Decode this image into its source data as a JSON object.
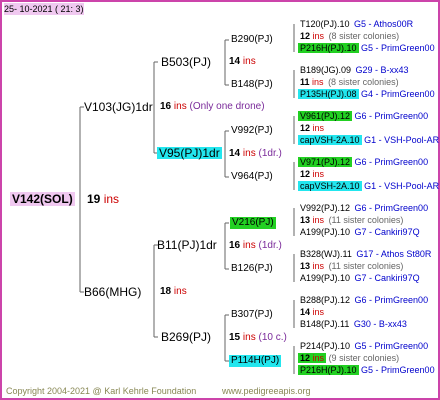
{
  "header": {
    "date": "25- 10-2021 ( 21: 3)"
  },
  "root": {
    "name": "V142(SOL)",
    "ins": "19",
    "ins_word": "ins"
  },
  "gen1": [
    {
      "name": "V103(JG)1dr",
      "ins": "16",
      "ins_word": "ins",
      "note": "(Only one drone)"
    },
    {
      "name": "B66(MHG)",
      "ins": "18",
      "ins_word": "ins"
    }
  ],
  "gen2": [
    {
      "name": "B503(PJ)",
      "ins": "14",
      "ins_word": "ins"
    },
    {
      "name": "V95(PJ)1dr",
      "ins": "14",
      "ins_word": "ins",
      "note": "(1dr.)"
    },
    {
      "name": "B11(PJ)1dr",
      "ins": "16",
      "ins_word": "ins",
      "note": "(1dr.)"
    },
    {
      "name": "B269(PJ)",
      "ins": "15",
      "ins_word": "ins",
      "note": "(10 c.)"
    }
  ],
  "gen3": [
    {
      "name": "B290(PJ)",
      "ins": "14",
      "ins_word": "ins"
    },
    {
      "name": "B148(PJ)",
      "ins": "",
      "ins_word": "ins"
    },
    {
      "name": "V992(PJ)",
      "ins": "",
      "ins_word": "ins"
    },
    {
      "name": "V964(PJ)",
      "ins": "",
      "ins_word": "ins"
    },
    {
      "name": "V216(PJ)",
      "ins": "",
      "ins_word": "ins"
    },
    {
      "name": "B126(PJ)",
      "ins": "",
      "ins_word": "ins"
    },
    {
      "name": "B307(PJ)",
      "ins": "",
      "ins_word": "ins"
    },
    {
      "name": "P114H(PJ)",
      "ins": "",
      "ins_word": "ins"
    }
  ],
  "gen4": [
    {
      "top": "T120(PJ).10",
      "top_ref": "G5 - Athos00R",
      "ins": "12",
      "ins_word": "ins",
      "ins_note": "(8 sister colonies)",
      "bottom": "P216H(PJ).10",
      "bottom_ref": "G5 - PrimGreen00"
    },
    {
      "top": "B189(JG).09",
      "top_ref": "G29 - B-xx43",
      "ins": "11",
      "ins_word": "ins",
      "ins_note": "(8 sister colonies)",
      "bottom": "P135H(PJ).08",
      "bottom_ref": "G4 - PrimGreen00"
    },
    {
      "top": "V961(PJ).12",
      "top_ref": "G6 - PrimGreen00",
      "ins": "12",
      "ins_word": "ins",
      "ins_note": "",
      "bottom": "capVSH-2A.10",
      "bottom_ref": "G1 - VSH-Pool-AR"
    },
    {
      "top": "V971(PJ).12",
      "top_ref": "G6 - PrimGreen00",
      "ins": "12",
      "ins_word": "ins",
      "ins_note": "",
      "bottom": "capVSH-2A.10",
      "bottom_ref": "G1 - VSH-Pool-AR"
    },
    {
      "top": "V992(PJ).12",
      "top_ref": "G6 - PrimGreen00",
      "ins": "13",
      "ins_word": "ins",
      "ins_note": "(11 sister colonies)",
      "bottom": "A199(PJ).10",
      "bottom_ref": "G7 - Cankiri97Q"
    },
    {
      "top": "B328(WJ).11",
      "top_ref": "G17 - Athos St80R",
      "ins": "13",
      "ins_word": "ins",
      "ins_note": "(11 sister colonies)",
      "bottom": "A199(PJ).10",
      "bottom_ref": "G7 - Cankiri97Q"
    },
    {
      "top": "B288(PJ).12",
      "top_ref": "G6 - PrimGreen00",
      "ins": "14",
      "ins_word": "ins",
      "ins_note": "",
      "bottom": "B148(PJ).11",
      "bottom_ref": "G30 - B-xx43"
    },
    {
      "top": "P214(PJ).10",
      "top_ref": "G5 - PrimGreen00",
      "ins": "12",
      "ins_word": "ins",
      "ins_note": "(9 sister colonies)",
      "bottom": "P216H(PJ).10",
      "bottom_ref": "G5 - PrimGreen00"
    }
  ],
  "footer": {
    "copyright": "Copyright 2004-2021 @ Karl Kehrle Foundation",
    "site": "www.pedigreeapis.org"
  },
  "colors": {
    "border": "#cc44aa",
    "green": "#22d022",
    "cyan": "#22e6ee",
    "pink": "#f0c8f0",
    "red": "#cc0000",
    "blue": "#0000cc"
  }
}
